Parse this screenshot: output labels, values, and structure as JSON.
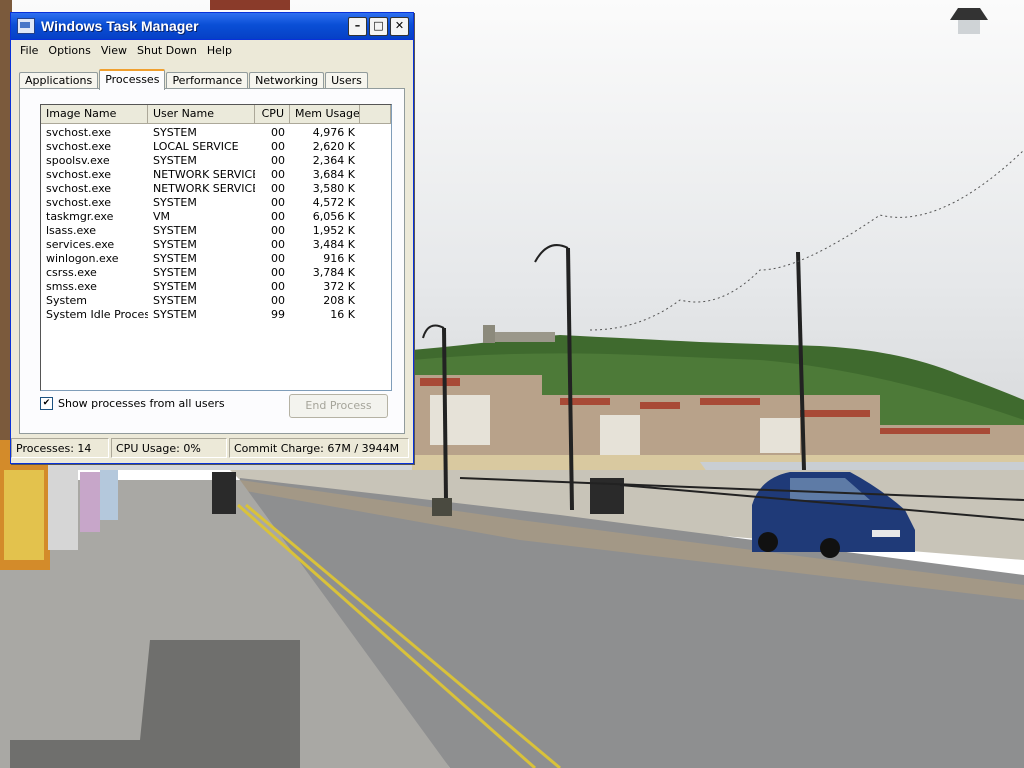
{
  "window": {
    "title": "Windows Task Manager",
    "minimize_glyph": "–",
    "maximize_glyph": "□",
    "close_glyph": "✕"
  },
  "menu": [
    "File",
    "Options",
    "View",
    "Shut Down",
    "Help"
  ],
  "tabs": [
    {
      "label": "Applications",
      "active": false
    },
    {
      "label": "Processes",
      "active": true
    },
    {
      "label": "Performance",
      "active": false
    },
    {
      "label": "Networking",
      "active": false
    },
    {
      "label": "Users",
      "active": false
    }
  ],
  "columns": [
    "Image Name",
    "User Name",
    "CPU",
    "Mem Usage"
  ],
  "processes": [
    [
      "svchost.exe",
      "SYSTEM",
      "00",
      "4,976 K"
    ],
    [
      "svchost.exe",
      "LOCAL SERVICE",
      "00",
      "2,620 K"
    ],
    [
      "spoolsv.exe",
      "SYSTEM",
      "00",
      "2,364 K"
    ],
    [
      "svchost.exe",
      "NETWORK SERVICE",
      "00",
      "3,684 K"
    ],
    [
      "svchost.exe",
      "NETWORK SERVICE",
      "00",
      "3,580 K"
    ],
    [
      "svchost.exe",
      "SYSTEM",
      "00",
      "4,572 K"
    ],
    [
      "taskmgr.exe",
      "VM",
      "00",
      "6,056 K"
    ],
    [
      "lsass.exe",
      "SYSTEM",
      "00",
      "1,952 K"
    ],
    [
      "services.exe",
      "SYSTEM",
      "00",
      "3,484 K"
    ],
    [
      "winlogon.exe",
      "SYSTEM",
      "00",
      "916 K"
    ],
    [
      "csrss.exe",
      "SYSTEM",
      "00",
      "3,784 K"
    ],
    [
      "smss.exe",
      "SYSTEM",
      "00",
      "372 K"
    ],
    [
      "System",
      "SYSTEM",
      "00",
      "208 K"
    ],
    [
      "System Idle Process",
      "SYSTEM",
      "99",
      "16 K"
    ]
  ],
  "show_all_processes": {
    "label": "Show processes from all users",
    "checked": true,
    "check_glyph": "✔"
  },
  "end_process_button": "End Process",
  "status": {
    "processes": "Processes: 14",
    "cpu_usage": "CPU Usage: 0%",
    "commit_charge": "Commit Charge: 67M / 3944M"
  },
  "colors": {
    "titlebar": "#0a4fd6",
    "window_face": "#ece9d8",
    "active_tab_accent": "#f0a030"
  }
}
